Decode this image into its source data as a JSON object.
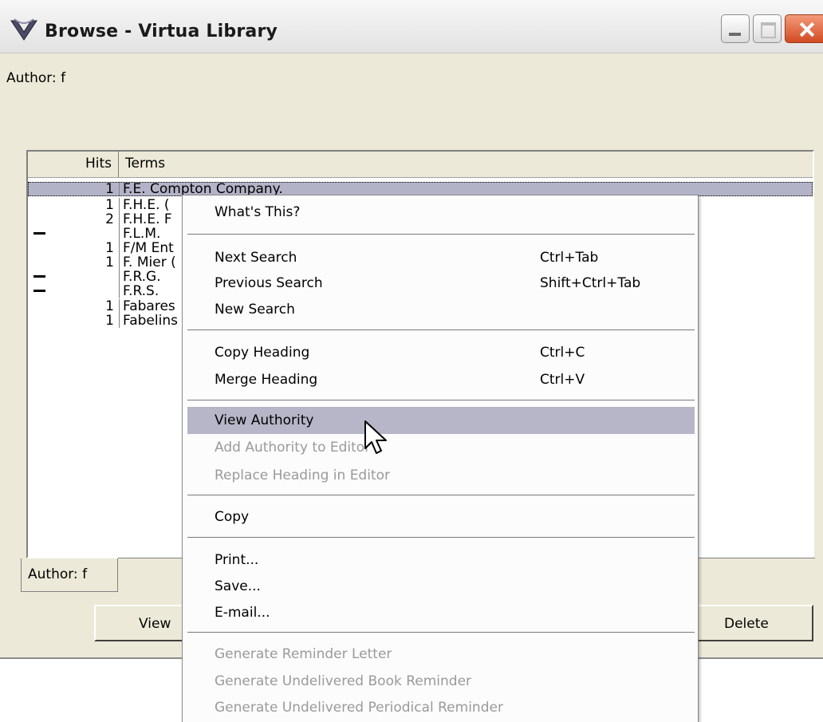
{
  "window": {
    "title": "Browse - Virtua Library"
  },
  "search_label": "Author: f",
  "list": {
    "headers": {
      "hits": "Hits",
      "terms": "Terms"
    },
    "rows": [
      {
        "hits": "1",
        "term": "F.E. Compton Company.",
        "marker": false
      },
      {
        "hits": "1",
        "term": "F.H.E. (",
        "marker": false
      },
      {
        "hits": "2",
        "term": "F.H.E. F",
        "marker": false
      },
      {
        "hits": "",
        "term": "F.L.M.",
        "marker": true
      },
      {
        "hits": "1",
        "term": "F/M Ent",
        "marker": false
      },
      {
        "hits": "1",
        "term": "F. Mier (",
        "marker": false
      },
      {
        "hits": "",
        "term": "F.R.G.",
        "marker": true
      },
      {
        "hits": "",
        "term": "F.R.S.",
        "marker": true
      },
      {
        "hits": "1",
        "term": "Fabares",
        "marker": false
      },
      {
        "hits": "1",
        "term": "Fabelins",
        "marker": false
      }
    ]
  },
  "tab": {
    "label": "Author: f"
  },
  "buttons": {
    "view": "View",
    "delete": "Delete"
  },
  "context_menu": {
    "whats_this": "What's This?",
    "next_search": {
      "label": "Next Search",
      "shortcut": "Ctrl+Tab"
    },
    "previous_search": {
      "label": "Previous Search",
      "shortcut": "Shift+Ctrl+Tab"
    },
    "new_search": "New Search",
    "copy_heading": {
      "label": "Copy Heading",
      "shortcut": "Ctrl+C"
    },
    "merge_heading": {
      "label": "Merge Heading",
      "shortcut": "Ctrl+V"
    },
    "view_authority": "View Authority",
    "add_authority": "Add Authority to Editor",
    "replace_heading": "Replace Heading in Editor",
    "copy": "Copy",
    "print": "Print...",
    "save": "Save...",
    "email": "E-mail...",
    "gen_reminder": "Generate Reminder Letter",
    "gen_book_reminder": "Generate Undelivered Book Reminder",
    "gen_periodical_reminder": "Generate Undelivered Periodical Reminder"
  }
}
